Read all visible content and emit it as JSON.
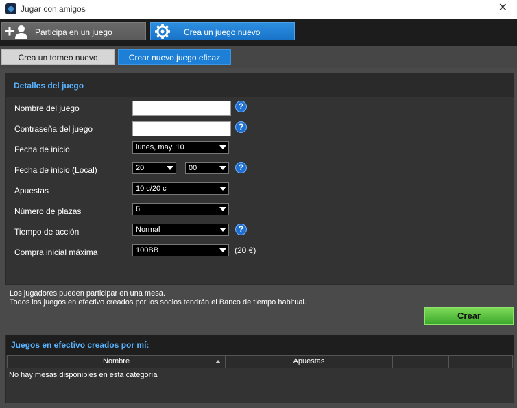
{
  "window": {
    "title": "Jugar con amigos",
    "close_glyph": "✕"
  },
  "top_tabs": [
    {
      "label": "Participa en un juego",
      "icon": "add-user-icon"
    },
    {
      "label": "Crea un juego nuevo",
      "icon": "gear-icon"
    }
  ],
  "sub_tabs": [
    {
      "label": "Crea un torneo nuevo"
    },
    {
      "label": "Crear nuevo juego eficaz"
    }
  ],
  "details": {
    "header": "Detalles del juego",
    "fields": {
      "nombre_label": "Nombre del juego",
      "contrasena_label": "Contraseña del juego",
      "fecha_label": "Fecha de inicio",
      "fecha_value": "lunes, may. 10",
      "fecha_local_label": "Fecha de inicio (Local)",
      "hora_value": "20",
      "minuto_value": "00",
      "apuestas_label": "Apuestas",
      "apuestas_value": "10 c/20 c",
      "plazas_label": "Número de plazas",
      "plazas_value": "6",
      "tiempo_label": "Tiempo de acción",
      "tiempo_value": "Normal",
      "compra_label": "Compra inicial máxima",
      "compra_value": "100BB",
      "compra_note": "(20 €)"
    },
    "help_glyph": "?"
  },
  "info": {
    "line1": "Los jugadores pueden participar en una mesa.",
    "line2": "Todos los juegos en efectivo creados por los socios tendrán el Banco de tiempo habitual."
  },
  "crear_button": "Crear",
  "mine": {
    "header": "Juegos en efectivo creados por mí:",
    "columns": [
      "Nombre",
      "Apuestas",
      "",
      ""
    ],
    "empty_text": "No hay mesas disponibles en esta categoría"
  },
  "colors": {
    "accent_blue": "#1d7fd6",
    "header_text": "#59b3ff",
    "create_green": "#3aa82c"
  }
}
